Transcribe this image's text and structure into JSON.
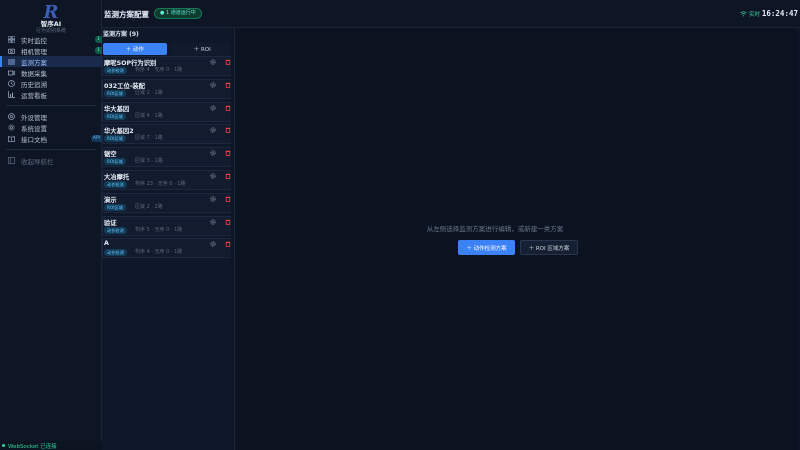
{
  "brand": {
    "name": "智序AI",
    "subtitle": "行为识别系统"
  },
  "sidebar": {
    "items": [
      {
        "label": "实时监控",
        "icon": "grid-icon",
        "badge": "1"
      },
      {
        "label": "相机管理",
        "icon": "camera-icon",
        "badge": "1"
      },
      {
        "label": "监测方案",
        "icon": "list-icon",
        "active": true
      },
      {
        "label": "数据采集",
        "icon": "video-icon"
      },
      {
        "label": "历史追溯",
        "icon": "history-icon"
      },
      {
        "label": "运营看板",
        "icon": "chart-icon"
      }
    ],
    "items2": [
      {
        "label": "外设管理",
        "icon": "peripheral-icon"
      },
      {
        "label": "系统设置",
        "icon": "gear-icon"
      },
      {
        "label": "接口文档",
        "icon": "book-icon",
        "badge": "API"
      }
    ],
    "collapse_label": "收起导航栏",
    "ws_status": "WebSocket 已连接"
  },
  "header": {
    "title": "监测方案配置",
    "run_badge": "● 1 通道运行中",
    "live_label": "实时",
    "clock": "16:24:47"
  },
  "list": {
    "title": "监测方案 (9)",
    "tab_action": "＋ 动作",
    "tab_roi": "＋ ROI",
    "schemes": [
      {
        "name": "摩呢SOP行为识别",
        "tag": "动作检测",
        "meta": "构序 4 · 无序 0 · 1路"
      },
      {
        "name": "032工位-装配",
        "tag": "ROI区域",
        "meta": "区域 2 · 1路"
      },
      {
        "name": "华大基因",
        "tag": "ROI区域",
        "meta": "区域 4 · 1路"
      },
      {
        "name": "华大基因2",
        "tag": "ROI区域",
        "meta": "区域 7 · 1路"
      },
      {
        "name": "锯空",
        "tag": "ROI区域",
        "meta": "区域 3 · 1路"
      },
      {
        "name": "大冶摩托",
        "tag": "动作检测",
        "meta": "构序 23 · 无序 0 · 1路"
      },
      {
        "name": "演示",
        "tag": "ROI区域",
        "meta": "区域 2 · 2路"
      },
      {
        "name": "验证",
        "tag": "动作检测",
        "meta": "构序 5 · 无序 0 · 1路"
      },
      {
        "name": "A",
        "tag": "动作检测",
        "meta": "构序 4 · 无序 0 · 1路"
      }
    ]
  },
  "main": {
    "hint": "从左侧选择监测方案进行编辑，或新建一类方案",
    "btn_action": "＋ 动作检测方案",
    "btn_roi": "＋ ROI 区域方案"
  },
  "colors": {
    "accent": "#3b82f6",
    "success": "#34d399",
    "danger": "#ef4444"
  }
}
